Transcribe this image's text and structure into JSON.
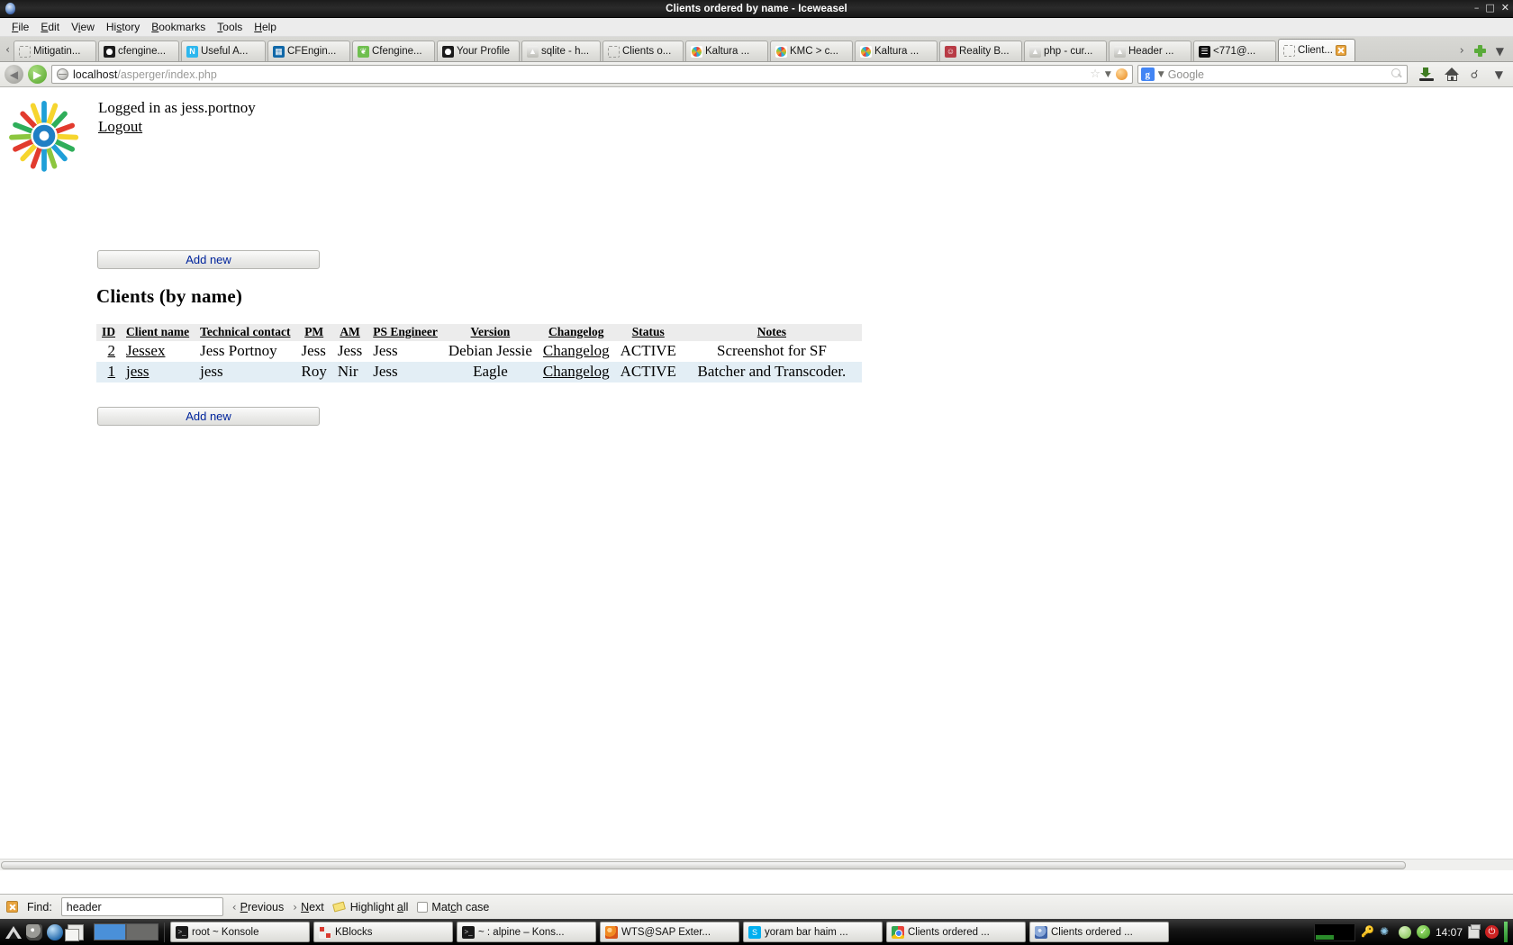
{
  "window": {
    "title": "Clients ordered by name - Iceweasel",
    "icon": "iceweasel-icon",
    "buttons": [
      "minimize",
      "maximize",
      "close"
    ]
  },
  "menubar": {
    "items": [
      {
        "label": "File",
        "accel": "F"
      },
      {
        "label": "Edit",
        "accel": "E"
      },
      {
        "label": "View",
        "accel": "V"
      },
      {
        "label": "History",
        "accel": "s"
      },
      {
        "label": "Bookmarks",
        "accel": "B"
      },
      {
        "label": "Tools",
        "accel": "T"
      },
      {
        "label": "Help",
        "accel": "H"
      }
    ]
  },
  "tabbar": {
    "scroll_left_icon": "chevron-left-icon",
    "new_tab_icon": "plus-icon",
    "list_all_icon": "chevron-down-icon",
    "scroll_right_icon": "chevron-right-icon",
    "tabs": [
      {
        "label": "Mitigatin...",
        "favicon": "blank-icon",
        "active": false
      },
      {
        "label": "cfengine...",
        "favicon": "github-icon",
        "active": false
      },
      {
        "label": "Useful A...",
        "favicon": "n-icon",
        "active": false
      },
      {
        "label": "CFEngin...",
        "favicon": "cfengine-icon",
        "active": false
      },
      {
        "label": "Cfengine...",
        "favicon": "cfengine-green-icon",
        "active": false
      },
      {
        "label": "Your Profile",
        "favicon": "github-icon",
        "active": false
      },
      {
        "label": "sqlite - h...",
        "favicon": "stackoverflow-icon",
        "active": false
      },
      {
        "label": "Clients o...",
        "favicon": "blank-icon",
        "active": false
      },
      {
        "label": "Kaltura ...",
        "favicon": "kaltura-icon",
        "active": false
      },
      {
        "label": "KMC > c...",
        "favicon": "kaltura-icon",
        "active": false
      },
      {
        "label": "Kaltura ...",
        "favicon": "kaltura-icon",
        "active": false
      },
      {
        "label": "Reality B...",
        "favicon": "reality-icon",
        "active": false
      },
      {
        "label": "php - cur...",
        "favicon": "stackoverflow-icon",
        "active": false
      },
      {
        "label": "Header ...",
        "favicon": "stackoverflow-icon",
        "active": false
      },
      {
        "label": "<771@...",
        "favicon": "mail-icon",
        "active": false
      },
      {
        "label": "Client...",
        "favicon": "blank-icon",
        "active": true,
        "close_icon": "close-icon"
      }
    ]
  },
  "navbar": {
    "back_icon": "back-arrow-icon",
    "forward_icon": "forward-arrow-icon",
    "site_icon": "globe-icon",
    "url_host": "localhost",
    "url_path": "/asperger/index.php",
    "bookmark_icon": "star-icon",
    "bookmark_chevron_icon": "chevron-down-icon",
    "rss_icon": "rss-icon",
    "search_engine_icon": "google-icon",
    "search_engine_chevron_icon": "chevron-down-icon",
    "search_placeholder": "Google",
    "search_value": "",
    "search_go_icon": "magnifier-icon",
    "downloads_icon": "download-icon",
    "home_icon": "home-icon",
    "addons_icon": "plugin-icon",
    "toolbar_chevron_icon": "chevron-down-icon"
  },
  "content": {
    "logo_name": "kaltura-sunburst-logo",
    "logged_in_text": "Logged in as jess.portnoy",
    "logout_label": "Logout",
    "add_new_top_label": "Add new",
    "add_new_bottom_label": "Add new",
    "page_title": "Clients (by name)",
    "table": {
      "columns": [
        "ID",
        "Client name",
        "Technical contact",
        "PM",
        "AM",
        "PS Engineer",
        "Version",
        "Changelog",
        "Status",
        "Notes"
      ],
      "rows": [
        {
          "id": "2",
          "client_name": "Jessex",
          "technical_contact": "Jess Portnoy",
          "pm": "Jess",
          "am": "Jess",
          "ps_engineer": "Jess",
          "version": "Debian Jessie",
          "changelog": "Changelog",
          "status": "ACTIVE",
          "notes": "Screenshot for SF",
          "highlighted": false
        },
        {
          "id": "1",
          "client_name": "jess",
          "technical_contact": "jess",
          "pm": "Roy",
          "am": "Nir",
          "ps_engineer": "Jess",
          "version": "Eagle",
          "changelog": "Changelog",
          "status": "ACTIVE",
          "notes": "Batcher and Transcoder.",
          "highlighted": true
        }
      ]
    }
  },
  "findbar": {
    "close_icon": "close-icon",
    "label": "Find:",
    "input_value": "header",
    "previous_label": "Previous",
    "next_label": "Next",
    "previous_icon": "chevron-left-icon",
    "next_icon": "chevron-right-icon",
    "highlight_icon": "highlighter-icon",
    "highlight_label": "Highlight all",
    "match_case_label": "Match case",
    "match_case_checked": false
  },
  "taskbar": {
    "launchers": [
      "kde-menu-icon",
      "file-manager-icon",
      "browser-icon",
      "window-list-icon"
    ],
    "pager": [
      {
        "active": true
      },
      {
        "active": false
      }
    ],
    "tasks": [
      {
        "label": "root ~ Konsole",
        "icon": "terminal-icon"
      },
      {
        "label": "KBlocks",
        "icon": "kblocks-icon"
      },
      {
        "label": "~ : alpine – Kons...",
        "icon": "terminal-icon"
      },
      {
        "label": "WTS@SAP Exter...",
        "icon": "firefox-icon"
      },
      {
        "label": "yoram bar haim ...",
        "icon": "skype-icon"
      },
      {
        "label": "Clients ordered ...",
        "icon": "chrome-icon"
      },
      {
        "label": "Clients ordered ...",
        "icon": "iceweasel-icon"
      }
    ],
    "tray": {
      "icons": [
        "klipper-icon",
        "network-icon",
        "volume-icon",
        "updates-icon"
      ],
      "clock": "14:07",
      "printer_icon": "printer-icon",
      "power_icon": "power-icon"
    }
  },
  "colors": {
    "accent_link": "#00249c",
    "row_highlight": "#e3eef5",
    "table_header_bg": "#ececec",
    "titlebar_bg": "#1b1b1b"
  }
}
